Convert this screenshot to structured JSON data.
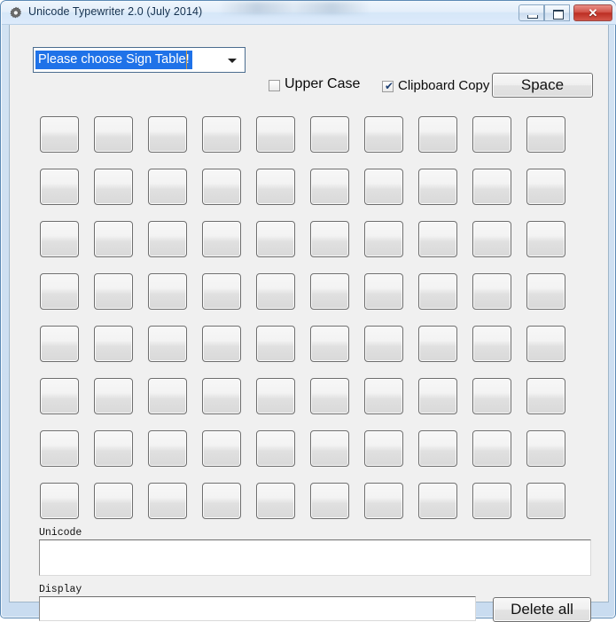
{
  "window": {
    "title": "Unicode Typewriter 2.0 (July 2014)",
    "icon": "gear-icon",
    "controls": {
      "minimize": "minimize-icon",
      "maximize": "maximize-icon",
      "close_label": "✕"
    }
  },
  "toolbar": {
    "sign_table": {
      "selected_value": "Please choose Sign Table!",
      "placeholder": "Please choose Sign Table!",
      "arrow_icon": "chevron-down-icon",
      "options": [
        "Please choose Sign Table!"
      ]
    },
    "upper_case": {
      "label": "Upper Case",
      "checked": false,
      "check_glyph": "✔"
    },
    "clipboard_copy": {
      "label": "Clipboard Copy",
      "checked": true,
      "check_glyph": "✔"
    },
    "space_button": "Space"
  },
  "grid": {
    "columns": 10,
    "rows": 8,
    "col_pitch": 61,
    "row_pitch": 59,
    "cells": [
      "",
      "",
      "",
      "",
      "",
      "",
      "",
      "",
      "",
      "",
      "",
      "",
      "",
      "",
      "",
      "",
      "",
      "",
      "",
      "",
      "",
      "",
      "",
      "",
      "",
      "",
      "",
      "",
      "",
      "",
      "",
      "",
      "",
      "",
      "",
      "",
      "",
      "",
      "",
      "",
      "",
      "",
      "",
      "",
      "",
      "",
      "",
      "",
      "",
      "",
      "",
      "",
      "",
      "",
      "",
      "",
      "",
      "",
      "",
      "",
      "",
      "",
      "",
      "",
      "",
      "",
      "",
      "",
      "",
      "",
      "",
      "",
      "",
      "",
      "",
      "",
      "",
      "",
      "",
      ""
    ]
  },
  "fields": {
    "unicode": {
      "label": "Unicode",
      "value": ""
    },
    "display": {
      "label": "Display",
      "value": ""
    }
  },
  "actions": {
    "delete_all": "Delete all"
  },
  "colors": {
    "selection_blue": "#1f72e8",
    "frame_blue": "#cfe0f2",
    "close_red": "#bc2e23",
    "client_gray": "#f0f0f0"
  }
}
